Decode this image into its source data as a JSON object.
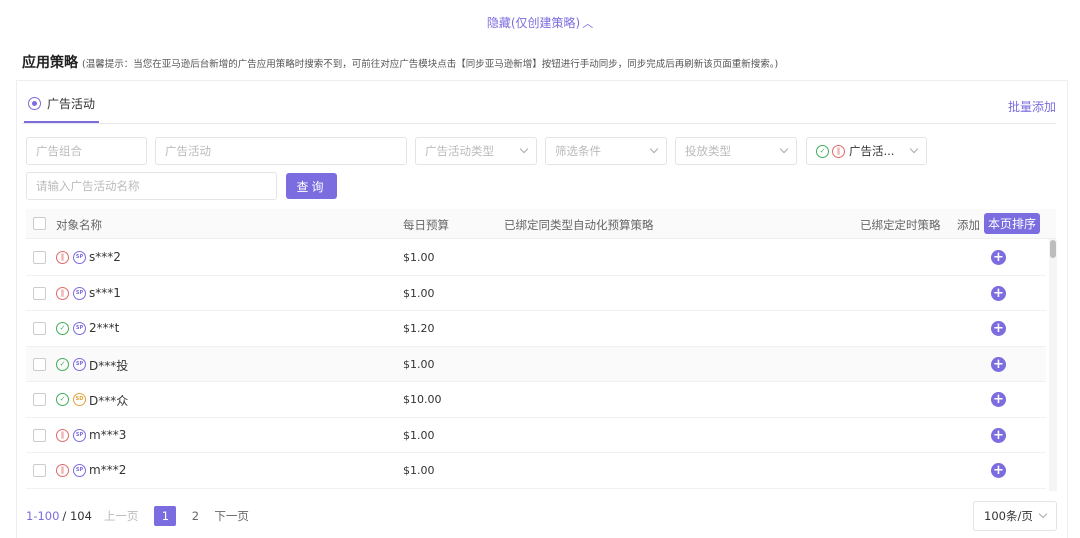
{
  "toggle": {
    "label": "隐藏(仅创建策略)"
  },
  "section": {
    "title": "应用策略",
    "hint": "(温馨提示：当您在亚马逊后台新增的广告应用策略时搜索不到，可前往对应广告模块点击【同步亚马逊新增】按钮进行手动同步，同步完成后再刷新该页面重新搜索。)"
  },
  "tab": {
    "label": "广告活动",
    "batch_add": "批量添加"
  },
  "filters": {
    "ad_group": "广告组合",
    "campaign": "广告活动",
    "campaign_type": "广告活动类型",
    "filter_cond": "筛选条件",
    "placement_type": "投放类型",
    "status_value": "广告活...",
    "name_placeholder": "请输入广告活动名称",
    "query_btn": "查询"
  },
  "table": {
    "headers": {
      "name": "对象名称",
      "budget": "每日预算",
      "auto_strategy": "已绑定同类型自动化预算策略",
      "timed_strategy": "已绑定定时策略",
      "add": "添加",
      "sort": "本页排序"
    },
    "rows": [
      {
        "name": "s***2",
        "budget": "$1.00",
        "status": "pause",
        "type": "SP",
        "highlight": false
      },
      {
        "name": "s***1",
        "budget": "$1.00",
        "status": "pause",
        "type": "SP",
        "highlight": false
      },
      {
        "name": "2***t",
        "budget": "$1.20",
        "status": "ok",
        "type": "SP",
        "highlight": false
      },
      {
        "name": "D***投",
        "budget": "$1.00",
        "status": "ok",
        "type": "SP",
        "highlight": true
      },
      {
        "name": "D***众",
        "budget": "$10.00",
        "status": "ok",
        "type": "SD",
        "highlight": false
      },
      {
        "name": "m***3",
        "budget": "$1.00",
        "status": "pause",
        "type": "SP",
        "highlight": false
      },
      {
        "name": "m***2",
        "budget": "$1.00",
        "status": "pause",
        "type": "SP",
        "highlight": false
      }
    ]
  },
  "pagination": {
    "range": "1-100",
    "total": "/ 104",
    "prev": "上一页",
    "pages": [
      "1",
      "2"
    ],
    "current": "1",
    "next": "下一页",
    "page_size": "100条/页"
  },
  "colors": {
    "accent": "#7b6cdf",
    "pause": "#e06a6a",
    "ok": "#3fae5a",
    "sd": "#e3a23c"
  }
}
